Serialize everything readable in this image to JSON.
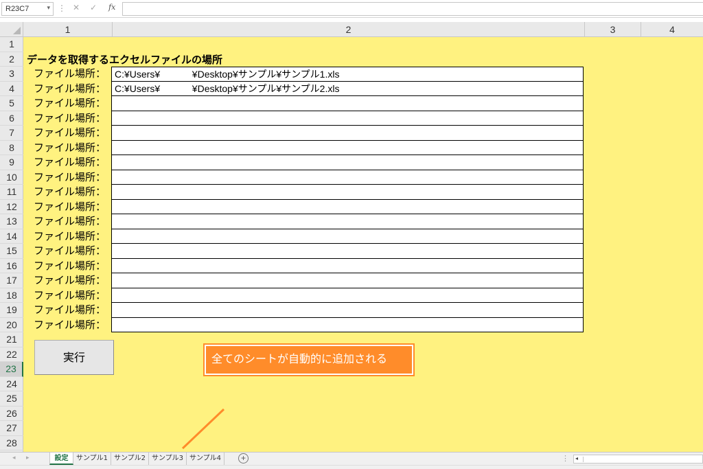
{
  "formula_bar": {
    "name_box": "R23C7",
    "cancel_icon": "✕",
    "enter_icon": "✓",
    "fx_label": "fx",
    "formula_value": ""
  },
  "columns": [
    "1",
    "2",
    "3",
    "4"
  ],
  "rows": [
    "1",
    "2",
    "3",
    "4",
    "5",
    "6",
    "7",
    "8",
    "9",
    "10",
    "11",
    "12",
    "13",
    "14",
    "15",
    "16",
    "17",
    "18",
    "19",
    "20",
    "21",
    "22",
    "23",
    "24",
    "25",
    "26",
    "27",
    "28"
  ],
  "active_row": "23",
  "sheet": {
    "heading": "データを取得するエクセルファイルの場所",
    "entries": [
      {
        "label": "ファイル場所：",
        "value": "C:¥Users¥            ¥Desktop¥サンプル¥サンプル1.xls"
      },
      {
        "label": "ファイル場所：",
        "value": "C:¥Users¥            ¥Desktop¥サンプル¥サンプル2.xls"
      },
      {
        "label": "ファイル場所：",
        "value": ""
      },
      {
        "label": "ファイル場所：",
        "value": ""
      },
      {
        "label": "ファイル場所：",
        "value": ""
      },
      {
        "label": "ファイル場所：",
        "value": ""
      },
      {
        "label": "ファイル場所：",
        "value": ""
      },
      {
        "label": "ファイル場所：",
        "value": ""
      },
      {
        "label": "ファイル場所：",
        "value": ""
      },
      {
        "label": "ファイル場所：",
        "value": ""
      },
      {
        "label": "ファイル場所：",
        "value": ""
      },
      {
        "label": "ファイル場所：",
        "value": ""
      },
      {
        "label": "ファイル場所：",
        "value": ""
      },
      {
        "label": "ファイル場所：",
        "value": ""
      },
      {
        "label": "ファイル場所：",
        "value": ""
      },
      {
        "label": "ファイル場所：",
        "value": ""
      },
      {
        "label": "ファイル場所：",
        "value": ""
      },
      {
        "label": "ファイル場所：",
        "value": ""
      }
    ],
    "run_button": "実行"
  },
  "callout": {
    "text": "全てのシートが自動的に追加される",
    "color": "#ff8c2a"
  },
  "tabs": [
    "設定",
    "サンプル1",
    "サンプル2",
    "サンプル3",
    "サンプル4"
  ],
  "active_tab": "設定",
  "colors": {
    "sheet_bg": "#fff280",
    "accent": "#217346"
  }
}
